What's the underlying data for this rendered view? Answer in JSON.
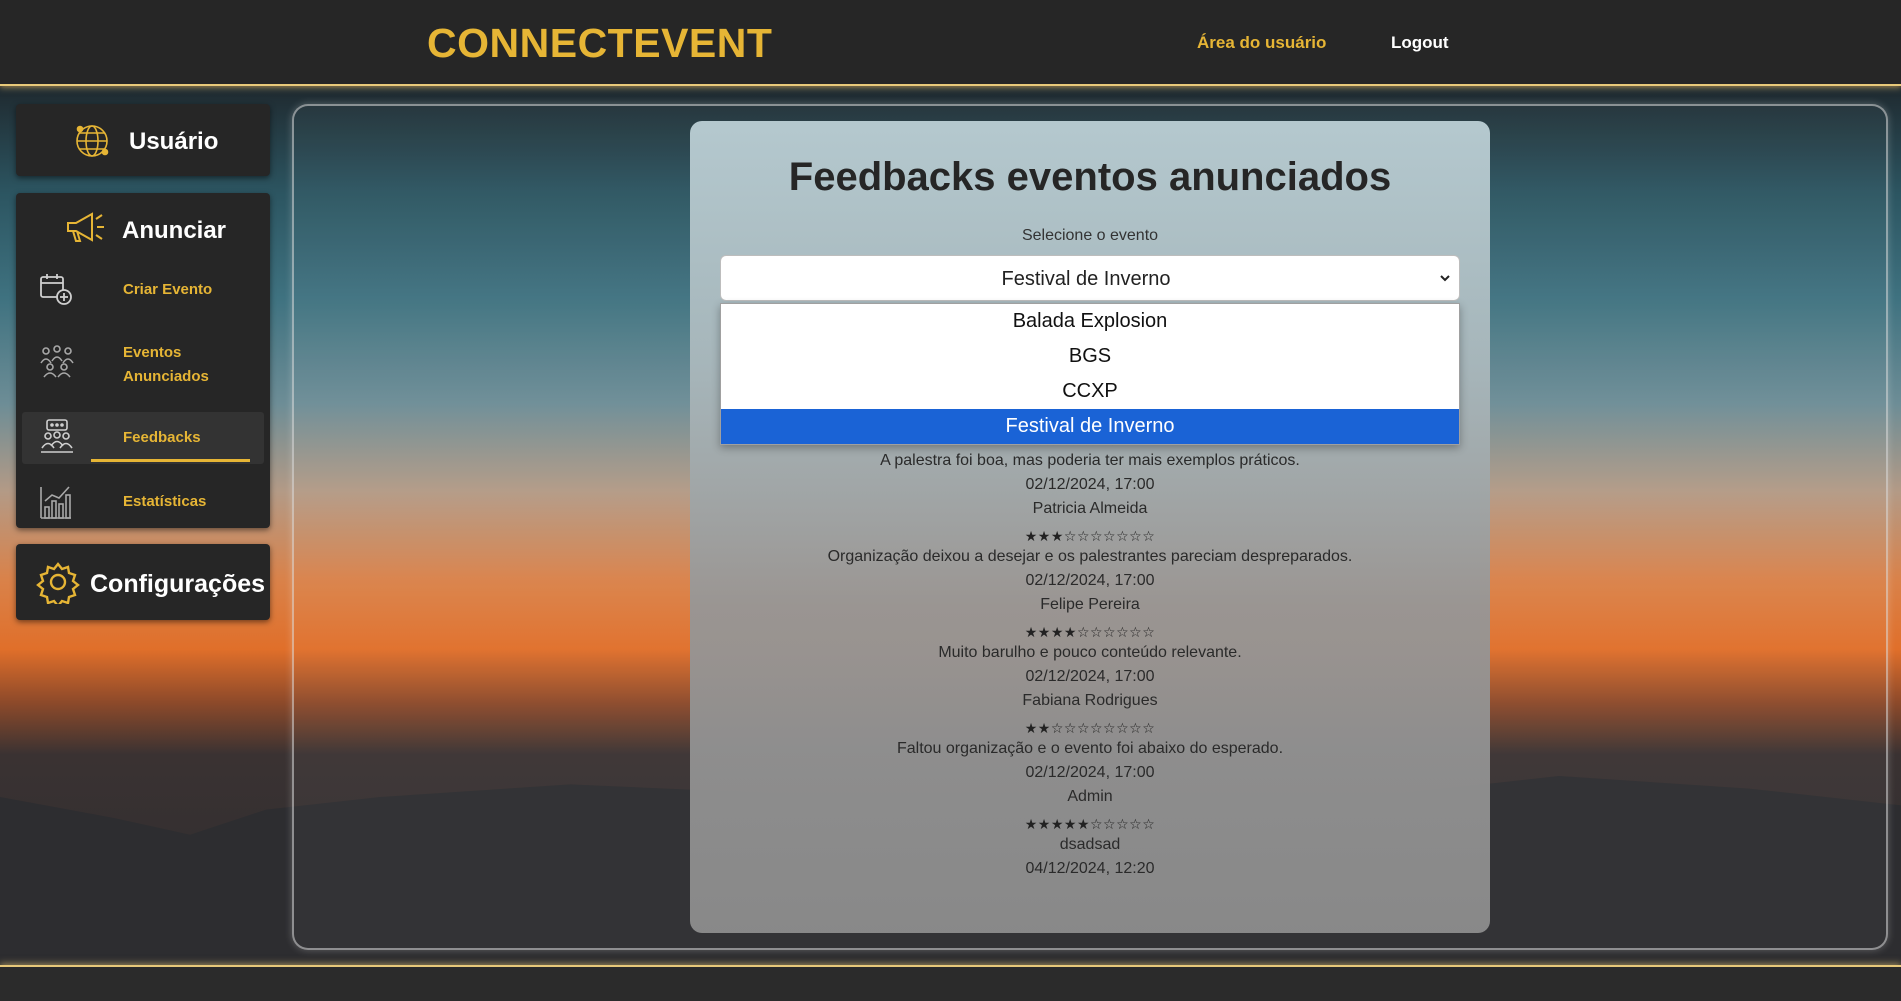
{
  "header": {
    "brand": "CONNECTEVENT",
    "nav_user": "Área do usuário",
    "nav_logout": "Logout"
  },
  "sidebar": {
    "user_title": "Usuário",
    "anunciar_title": "Anunciar",
    "items": [
      {
        "label": "Criar Evento",
        "icon": "calendar-plus-icon"
      },
      {
        "label": "Eventos Anunciados",
        "icon": "people-group-icon"
      },
      {
        "label": "Feedbacks",
        "icon": "feedback-people-icon",
        "active": true
      },
      {
        "label": "Estatísticas",
        "icon": "bar-chart-icon"
      }
    ],
    "config_title": "Configurações"
  },
  "main": {
    "title": "Feedbacks eventos anunciados",
    "select_label": "Selecione o evento",
    "selected_event": "Festival de Inverno",
    "options": [
      "Balada Explosion",
      "BGS",
      "CCXP",
      "Festival de Inverno"
    ],
    "feedbacks_top": [
      {
        "stars": "★★★★★★★☆☆☆",
        "comment": "A palestra foi boa, mas poderia ter mais exemplos práticos.",
        "date": "02/12/2024, 17:00"
      }
    ],
    "feedbacks": [
      {
        "name": "Patricia Almeida",
        "stars": "★★★☆☆☆☆☆☆☆",
        "comment": "Organização deixou a desejar e os palestrantes pareciam despreparados.",
        "date": "02/12/2024, 17:00"
      },
      {
        "name": "Felipe Pereira",
        "stars": "★★★★☆☆☆☆☆☆",
        "comment": "Muito barulho e pouco conteúdo relevante.",
        "date": "02/12/2024, 17:00"
      },
      {
        "name": "Fabiana Rodrigues",
        "stars": "★★☆☆☆☆☆☆☆☆",
        "comment": "Faltou organização e o evento foi abaixo do esperado.",
        "date": "02/12/2024, 17:00"
      },
      {
        "name": "Admin",
        "stars": "★★★★★☆☆☆☆☆",
        "comment": "dsadsad",
        "date": "04/12/2024, 12:20"
      }
    ]
  },
  "colors": {
    "accent": "#e6b535",
    "selected_option": "#1a63d6",
    "bar_bg": "#262626"
  }
}
